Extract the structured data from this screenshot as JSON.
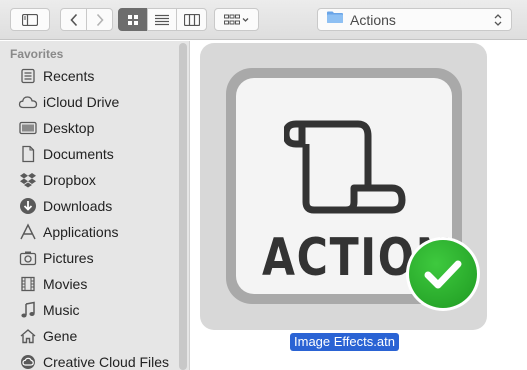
{
  "window": {
    "folder_name": "Actions"
  },
  "toolbar": {
    "sidebar_toggle_icon": "sidebar-icon",
    "back_icon": "chevron-left-icon",
    "forward_icon": "chevron-right-icon",
    "view_modes": [
      "icon-view",
      "list-view",
      "column-view"
    ],
    "active_view": "icon-view",
    "arrange_icon": "arrange-grid-icon",
    "path_icon": "folder-icon"
  },
  "sidebar": {
    "heading": "Favorites",
    "items": [
      {
        "label": "Recents",
        "icon": "recents-icon"
      },
      {
        "label": "iCloud Drive",
        "icon": "cloud-icon"
      },
      {
        "label": "Desktop",
        "icon": "desktop-icon"
      },
      {
        "label": "Documents",
        "icon": "document-icon"
      },
      {
        "label": "Dropbox",
        "icon": "dropbox-icon"
      },
      {
        "label": "Downloads",
        "icon": "download-icon"
      },
      {
        "label": "Applications",
        "icon": "applications-icon"
      },
      {
        "label": "Pictures",
        "icon": "camera-icon"
      },
      {
        "label": "Movies",
        "icon": "film-icon"
      },
      {
        "label": "Music",
        "icon": "music-note-icon"
      },
      {
        "label": "Gene",
        "icon": "home-icon"
      },
      {
        "label": "Creative Cloud Files",
        "icon": "creative-cloud-icon"
      }
    ]
  },
  "content": {
    "file": {
      "name": "Image Effects.atn",
      "icon_caption": "ACTIONS",
      "selected": true,
      "badge": "checkmark-icon"
    }
  },
  "colors": {
    "selection": "#2a63d4",
    "badge_green": "#2bb02b",
    "folder_blue": "#6aa5e8"
  }
}
